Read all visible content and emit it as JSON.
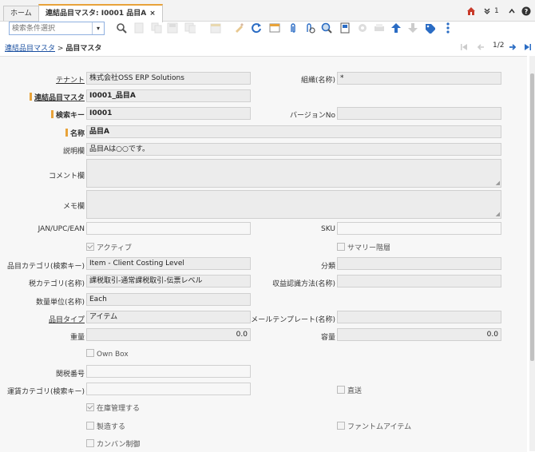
{
  "tabs": {
    "home": "ホーム",
    "active": "連結品目マスタ: I0001 品目A",
    "close": "×"
  },
  "header_right": {
    "count": "1"
  },
  "search": {
    "placeholder": "検索条件選択"
  },
  "breadcrumb": {
    "parent": "連結品目マスタ",
    "separator": ">",
    "current": "品目マスタ"
  },
  "pager": {
    "position": "1/2"
  },
  "form": {
    "tenant_label": "テナント",
    "tenant_value": "株式会社OSS ERP Solutions",
    "org_label": "組織(名称)",
    "org_value": "*",
    "linked_item_label": "連結品目マスタ",
    "linked_item_value": "I0001_品目A",
    "search_key_label": "検索キー",
    "search_key_value": "I0001",
    "version_label": "バージョンNo",
    "version_value": "",
    "name_label": "名称",
    "name_value": "品目A",
    "description_label": "説明欄",
    "description_value": "品目Aは○○です。",
    "comment_label": "コメント欄",
    "memo_label": "メモ欄",
    "jan_label": "JAN/UPC/EAN",
    "sku_label": "SKU",
    "active_label": "アクティブ",
    "active_checked": true,
    "summary_label": "サマリー階層",
    "summary_checked": false,
    "category_label": "品目カテゴリ(検索キー)",
    "category_value": "Item - Client Costing Level",
    "classification_label": "分類",
    "tax_category_label": "税カテゴリ(名称)",
    "tax_category_value": "課税取引-通常課税取引-伝票レベル",
    "revenue_label": "収益認識方法(名称)",
    "uom_label": "数量単位(名称)",
    "uom_value": "Each",
    "item_type_label": "品目タイプ",
    "item_type_value": "アイテム",
    "mail_template_label": "メールテンプレート(名称)",
    "weight_label": "重量",
    "weight_value": "0.0",
    "volume_label": "容量",
    "volume_value": "0.0",
    "own_box_label": "Own Box",
    "own_box_checked": false,
    "tariff_label": "関税番号",
    "freight_label": "運賃カテゴリ(検索キー)",
    "drop_ship_label": "直送",
    "drop_ship_checked": false,
    "stocked_label": "在庫管理する",
    "stocked_checked": true,
    "manufactured_label": "製造する",
    "manufactured_checked": false,
    "phantom_label": "ファントムアイテム",
    "phantom_checked": false,
    "kanban_label": "カンバン制御",
    "kanban_checked": false
  },
  "colors": {
    "accent": "#e8a33a",
    "link": "#1a4fa0",
    "icon_blue": "#2a6cc4"
  },
  "icons": [
    "home-icon",
    "double-chevron-down-icon",
    "chevron-up-icon",
    "help-icon",
    "search-icon",
    "new-icon",
    "copy-icon",
    "save-icon",
    "save-new-icon",
    "delete-icon",
    "edit-icon",
    "refresh-icon",
    "window-icon",
    "attachment-icon",
    "zoom-across-icon",
    "lookup-icon",
    "archive-icon",
    "settings-icon",
    "print-icon",
    "arrow-up-icon",
    "arrow-down-icon",
    "tag-icon",
    "more-icon",
    "first-page-icon",
    "prev-page-icon",
    "next-page-icon",
    "last-page-icon"
  ]
}
